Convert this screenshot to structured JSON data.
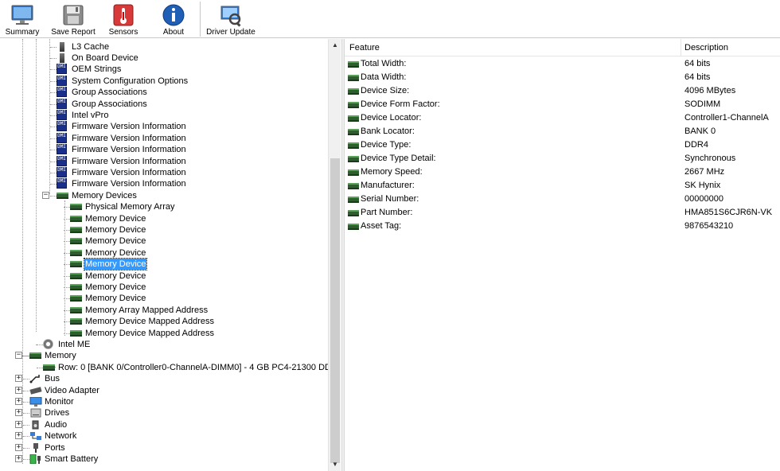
{
  "toolbar": {
    "buttons": [
      {
        "label": "Summary",
        "icon": "monitor-icon"
      },
      {
        "label": "Save Report",
        "icon": "floppy-disk-icon"
      },
      {
        "label": "Sensors",
        "icon": "thermometer-icon"
      },
      {
        "label": "About",
        "icon": "info-icon"
      },
      {
        "label": "Driver Update",
        "icon": "driver-update-icon"
      }
    ]
  },
  "tree": {
    "dmi_icon_text": "DMI",
    "expand_symbol": "+",
    "collapse_symbol": "−",
    "items": [
      "L3 Cache",
      "On Board Device",
      "OEM Strings",
      "System Configuration Options",
      "Group Associations",
      "Group Associations",
      "Intel vPro",
      "Firmware Version Information",
      "Firmware Version Information",
      "Firmware Version Information",
      "Firmware Version Information",
      "Firmware Version Information",
      "Firmware Version Information",
      "Memory Devices",
      "Physical Memory Array",
      "Memory Device",
      "Memory Device",
      "Memory Device",
      "Memory Device",
      "Memory Device",
      "Memory Device",
      "Memory Device",
      "Memory Device",
      "Memory Array Mapped Address",
      "Memory Device Mapped Address",
      "Memory Device Mapped Address",
      "Intel ME",
      "Memory",
      "Row: 0 [BANK 0/Controller0-ChannelA-DIMM0] - 4 GB PC4-21300 DD",
      "Bus",
      "Video Adapter",
      "Monitor",
      "Drives",
      "Audio",
      "Network",
      "Ports",
      "Smart Battery"
    ],
    "selected_index": 19
  },
  "scrollbar": {
    "up": "▲",
    "down": "▼"
  },
  "detail": {
    "col_feature": "Feature",
    "col_description": "Description",
    "rows": [
      {
        "feature": "Total Width:",
        "value": "64 bits"
      },
      {
        "feature": "Data Width:",
        "value": "64 bits"
      },
      {
        "feature": "Device Size:",
        "value": "4096 MBytes"
      },
      {
        "feature": "Device Form Factor:",
        "value": "SODIMM"
      },
      {
        "feature": "Device Locator:",
        "value": "Controller1-ChannelA"
      },
      {
        "feature": "Bank Locator:",
        "value": "BANK 0"
      },
      {
        "feature": "Device Type:",
        "value": "DDR4"
      },
      {
        "feature": "Device Type Detail:",
        "value": "Synchronous"
      },
      {
        "feature": "Memory Speed:",
        "value": "2667 MHz"
      },
      {
        "feature": "Manufacturer:",
        "value": "SK Hynix"
      },
      {
        "feature": "Serial Number:",
        "value": "00000000"
      },
      {
        "feature": "Part Number:",
        "value": "HMA851S6CJR6N-VK"
      },
      {
        "feature": "Asset Tag:",
        "value": "9876543210"
      }
    ]
  },
  "colors": {
    "selection": "#3399ff",
    "dmi_icon": "#1a2f8a",
    "memory_icon": "#2e5e2e"
  }
}
